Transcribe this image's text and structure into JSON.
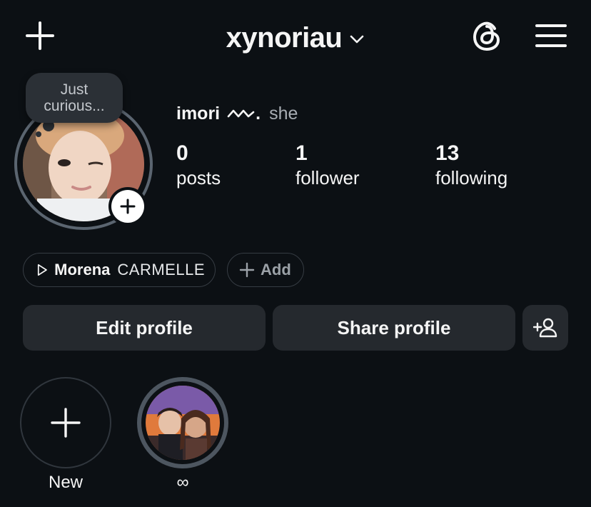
{
  "header": {
    "username": "xynoriau",
    "icons": {
      "create": "plus-icon",
      "account_switch": "chevron-down-icon",
      "threads": "threads-icon",
      "menu": "hamburger-menu-icon"
    }
  },
  "note": {
    "line1": "Just",
    "line2": "curious..."
  },
  "profile": {
    "name": "imori",
    "name_suffix": ".",
    "pronouns": "she",
    "stats": [
      {
        "value": "0",
        "label": "posts"
      },
      {
        "value": "1",
        "label": "follower"
      },
      {
        "value": "13",
        "label": "following"
      }
    ]
  },
  "chips": {
    "song": {
      "artist": "Morena",
      "title": "CARMELLE"
    },
    "add_label": "Add"
  },
  "buttons": {
    "edit": "Edit profile",
    "share": "Share profile"
  },
  "highlights": [
    {
      "label": "New"
    },
    {
      "label": "∞"
    }
  ],
  "colors": {
    "background": "#0c1014",
    "button_bg": "#25292e",
    "muted_text": "#a8adb3"
  }
}
